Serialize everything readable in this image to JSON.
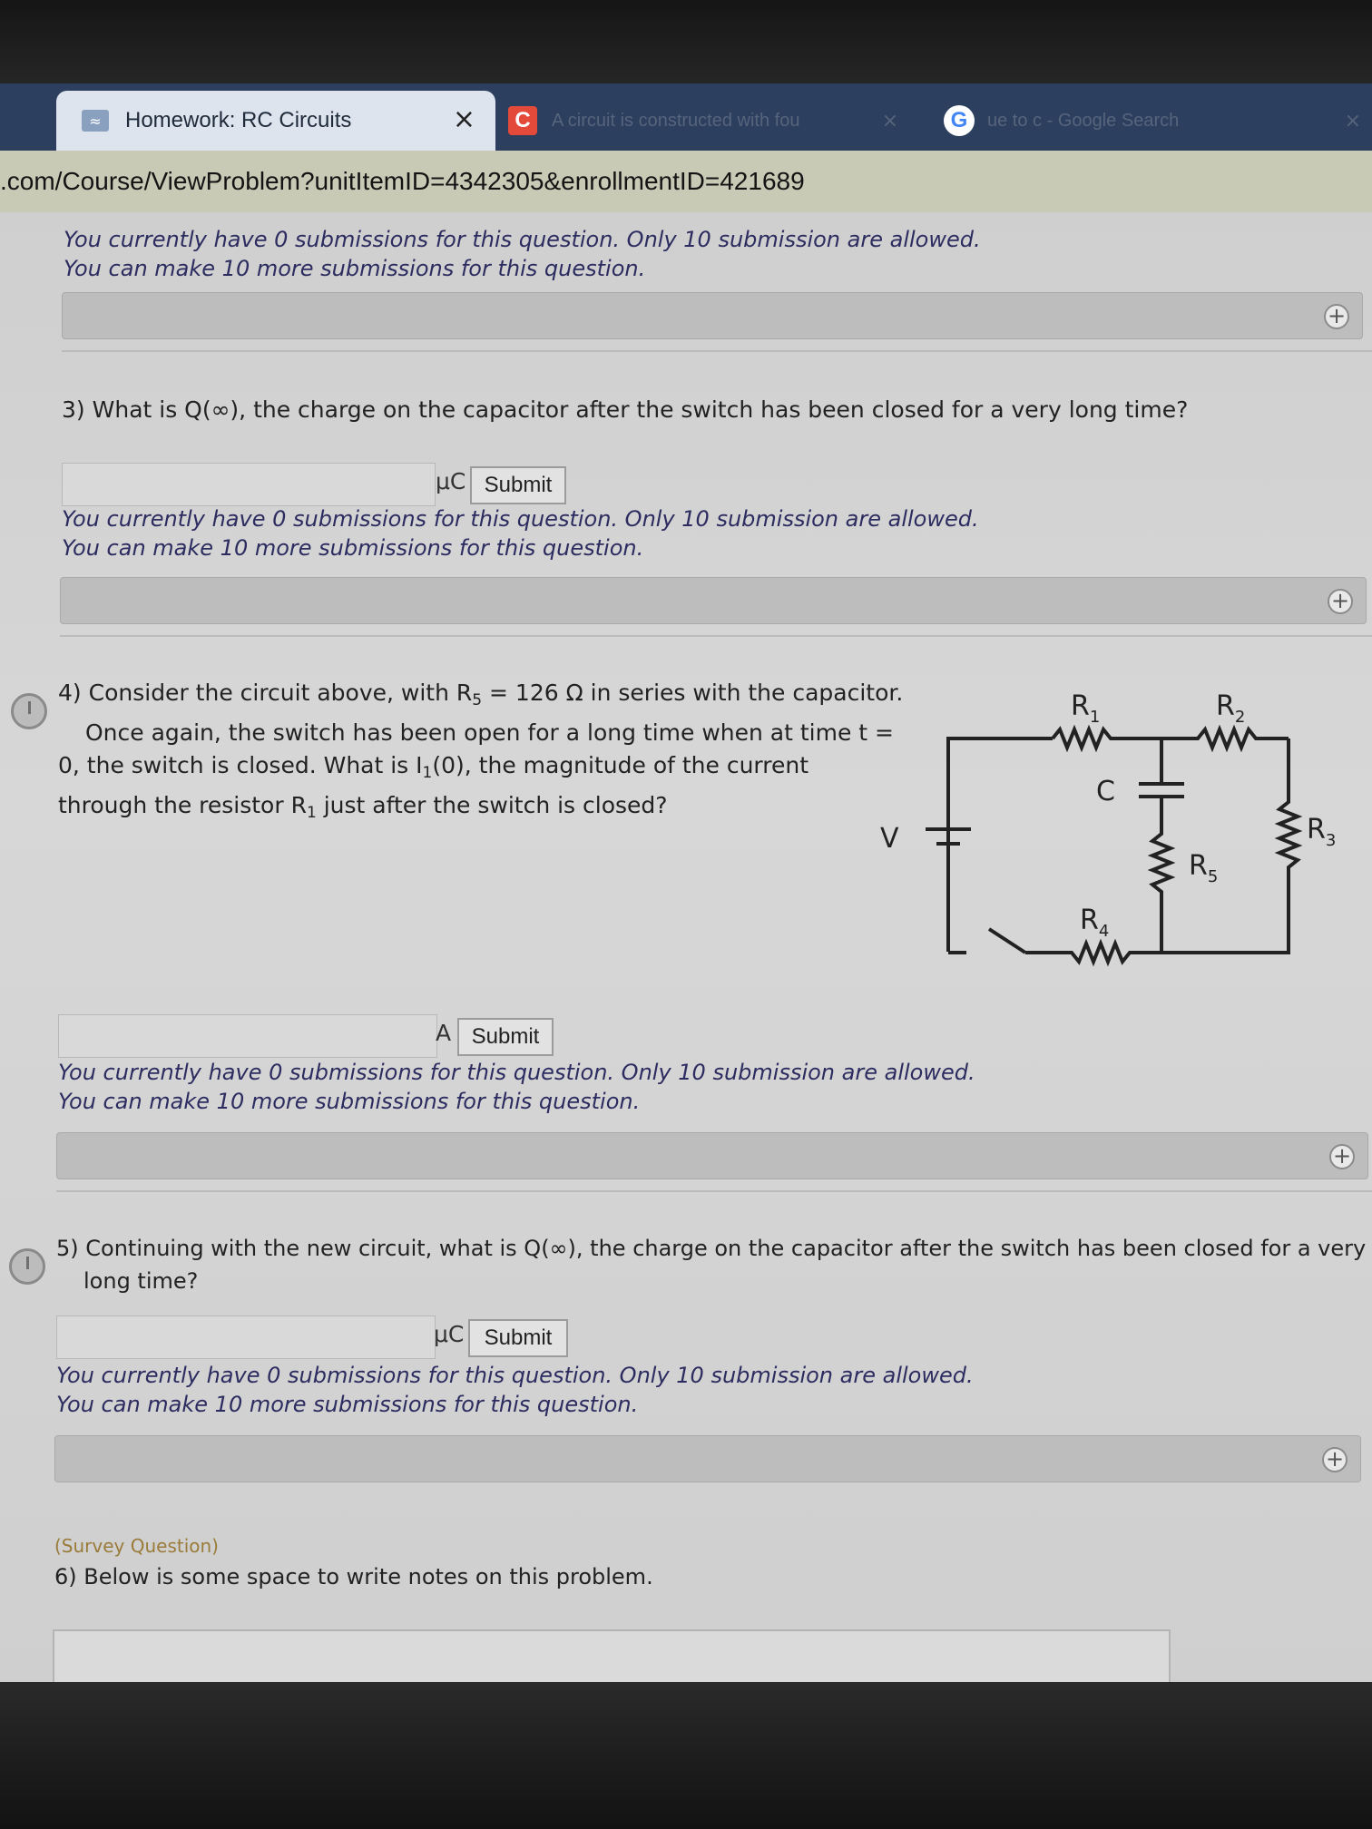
{
  "browser": {
    "active_tab_title": "Homework: RC Circuits",
    "tab2_title": "A circuit is constructed with fou",
    "tab3_title": "ue to c - Google Search",
    "close_glyph": "×",
    "url": ".com/Course/ViewProblem?unitItemID=4342305&enrollmentID=421689"
  },
  "submission_note": {
    "line1": "You currently have 0 submissions for this question. Only 10 submission are allowed.",
    "line2": "You can make 10 more submissions for this question."
  },
  "questions": [
    {
      "number": "3)",
      "text": "What is Q(∞), the charge on the capacitor after the switch has been closed for a very long time?",
      "unit": "μC",
      "submit_label": "Submit"
    },
    {
      "number": "4)",
      "line1_a": "Consider the circuit above, with R",
      "line1_sub": "5",
      "line1_b": " = 126 Ω in series with the capacitor.",
      "line2": "Once again, the switch has been open for a long time when at time t =",
      "line3_a": "0, the switch is closed. What is I",
      "line3_sub": "1",
      "line3_b": "(0), the magnitude of the current",
      "line4_a": "through the resistor R",
      "line4_sub": "1",
      "line4_b": " just after the switch is closed?",
      "unit": "A",
      "submit_label": "Submit"
    },
    {
      "number": "5)",
      "line1": "Continuing with the new circuit, what is Q(∞), the charge on the capacitor after the switch has been closed for a very",
      "line2": "long time?",
      "unit": "μC",
      "submit_label": "Submit"
    },
    {
      "survey_label": "(Survey Question)",
      "number": "6)",
      "text": "Below is some space to write notes on this problem."
    }
  ],
  "circuit": {
    "labels": {
      "r1": "R",
      "r1_sub": "1",
      "r2": "R",
      "r2_sub": "2",
      "r3": "R",
      "r3_sub": "3",
      "r4": "R",
      "r4_sub": "4",
      "r5": "R",
      "r5_sub": "5",
      "c": "C",
      "v": "V"
    }
  },
  "icons": {
    "hint": "plus-circle-icon",
    "status": "clock-icon",
    "favicon": "mastering-icon"
  }
}
